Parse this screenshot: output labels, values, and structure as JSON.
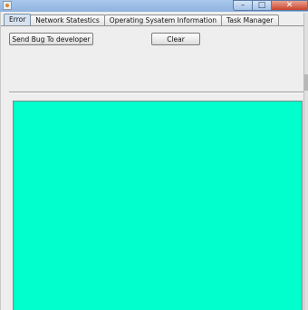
{
  "window": {
    "icon": "java-cup-icon",
    "controls": {
      "minimize": "–",
      "maximize": "□",
      "close": "✕"
    }
  },
  "tabs": [
    {
      "label": "Error",
      "active": true
    },
    {
      "label": "Network Statestics",
      "active": false
    },
    {
      "label": "Operating Sysatem Information",
      "active": false
    },
    {
      "label": "Task Manager",
      "active": false
    }
  ],
  "error_panel": {
    "send_bug_label": "Send Bug To developer",
    "clear_label": "Clear",
    "output_text": "",
    "output_background": "#00ffcc"
  }
}
